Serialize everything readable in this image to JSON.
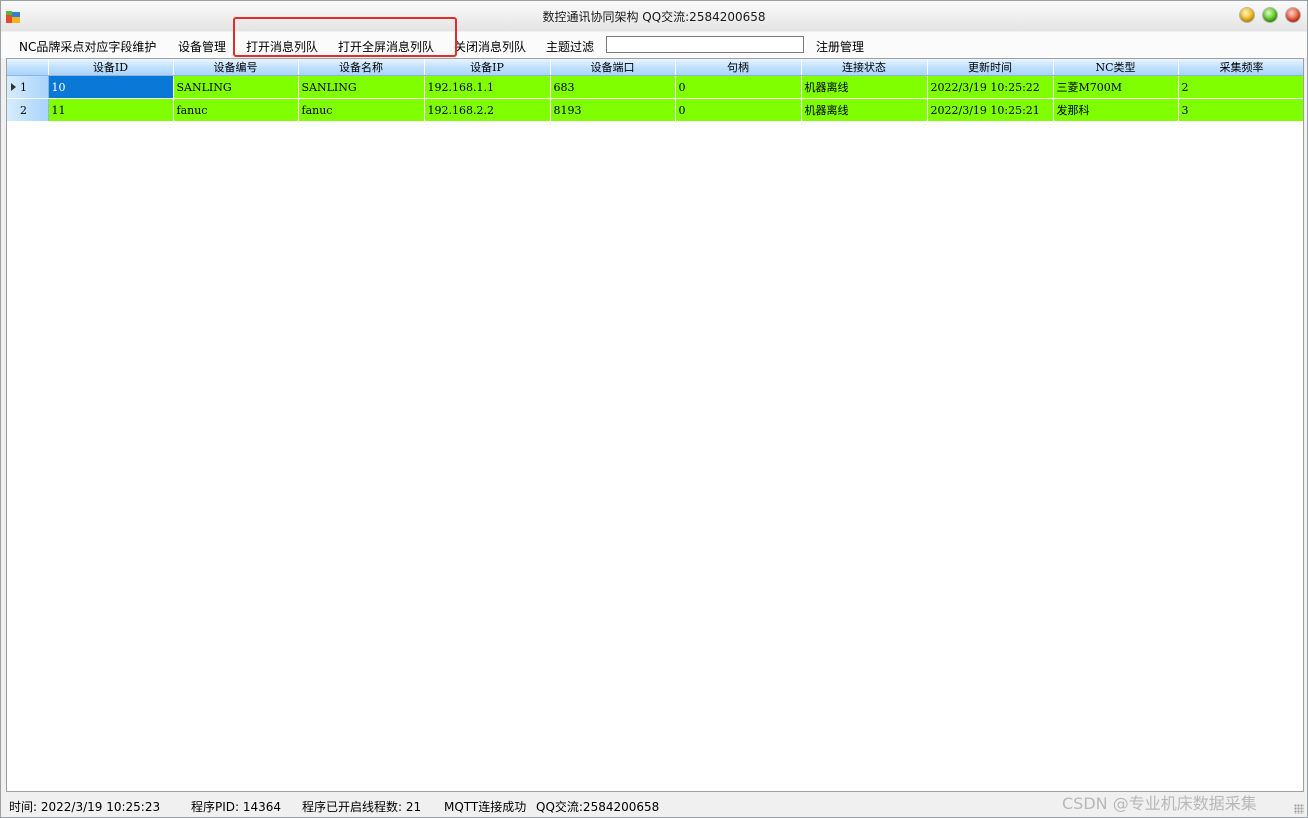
{
  "window": {
    "title": "数控通讯协同架构 QQ交流:2584200658"
  },
  "menu": {
    "items": [
      {
        "label": "NC品牌采点对应字段维护"
      },
      {
        "label": "设备管理"
      },
      {
        "label": "打开消息列队"
      },
      {
        "label": "打开全屏消息列队"
      },
      {
        "label": "关闭消息列队"
      },
      {
        "label": "主题过滤"
      },
      {
        "label": "注册管理"
      }
    ],
    "filter_value": ""
  },
  "grid": {
    "columns": [
      "设备ID",
      "设备编号",
      "设备名称",
      "设备IP",
      "设备端口",
      "句柄",
      "连接状态",
      "更新时间",
      "NC类型",
      "采集频率"
    ],
    "rows": [
      {
        "num": "1",
        "cells": [
          "10",
          "SANLING",
          "SANLING",
          "192.168.1.1",
          "683",
          "0",
          "机器离线",
          "2022/3/19 10:25:22",
          "三菱M700M",
          "2"
        ]
      },
      {
        "num": "2",
        "cells": [
          "11",
          "fanuc",
          "fanuc",
          "192.168.2.2",
          "8193",
          "0",
          "机器离线",
          "2022/3/19 10:25:21",
          "发那科",
          "3"
        ]
      }
    ]
  },
  "status": {
    "time": "时间: 2022/3/19 10:25:23",
    "pid": "程序PID: 14364",
    "threads": "程序已开启线程数: 21",
    "mqtt": "MQTT连接成功",
    "qq": "QQ交流:2584200658"
  },
  "watermark": "CSDN @专业机床数据采集",
  "colors": {
    "row_background": "#7fff00",
    "selected_cell": "#0a78d7",
    "highlight_box": "#e62b2b"
  }
}
